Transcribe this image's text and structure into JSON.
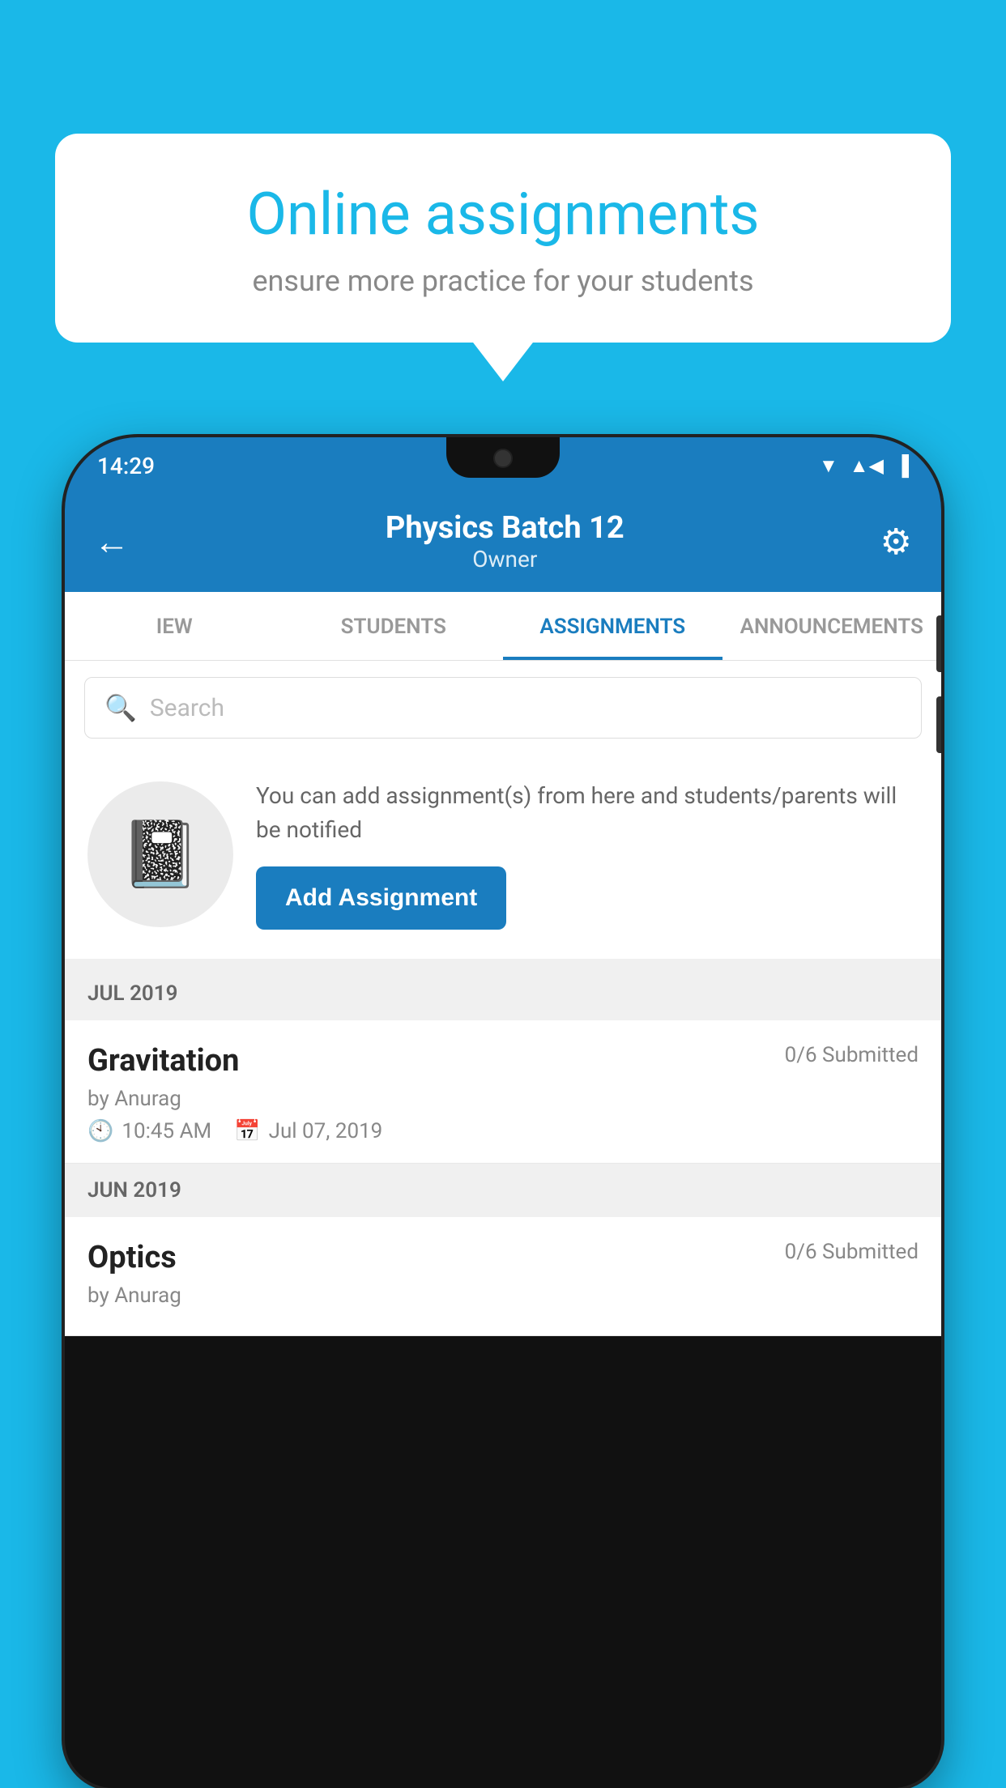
{
  "background_color": "#1ab8e8",
  "speech_bubble": {
    "title": "Online assignments",
    "subtitle": "ensure more practice for your students"
  },
  "phone": {
    "status_bar": {
      "time": "14:29"
    },
    "header": {
      "title": "Physics Batch 12",
      "subtitle": "Owner",
      "back_label": "←",
      "settings_label": "⚙"
    },
    "tabs": [
      {
        "label": "IEW",
        "active": false
      },
      {
        "label": "STUDENTS",
        "active": false
      },
      {
        "label": "ASSIGNMENTS",
        "active": true
      },
      {
        "label": "ANNOUNCEMENTS",
        "active": false
      }
    ],
    "search": {
      "placeholder": "Search"
    },
    "promo": {
      "text": "You can add assignment(s) from here and students/parents will be notified",
      "button_label": "Add Assignment"
    },
    "sections": [
      {
        "month": "JUL 2019",
        "assignments": [
          {
            "name": "Gravitation",
            "submitted": "0/6 Submitted",
            "author": "by Anurag",
            "time": "10:45 AM",
            "date": "Jul 07, 2019"
          }
        ]
      },
      {
        "month": "JUN 2019",
        "assignments": [
          {
            "name": "Optics",
            "submitted": "0/6 Submitted",
            "author": "by Anurag",
            "time": "",
            "date": ""
          }
        ]
      }
    ]
  }
}
